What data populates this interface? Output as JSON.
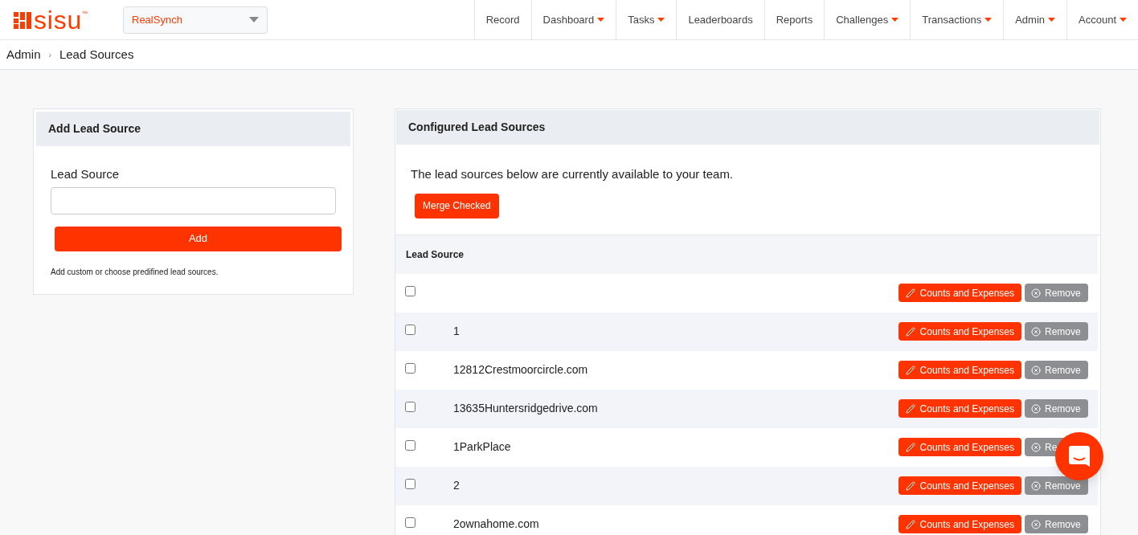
{
  "logo": {
    "text": "sisu",
    "mark": "™"
  },
  "team_select": {
    "value": "RealSynch"
  },
  "nav": [
    {
      "label": "Record",
      "has_menu": false
    },
    {
      "label": "Dashboard",
      "has_menu": true
    },
    {
      "label": "Tasks",
      "has_menu": true
    },
    {
      "label": "Leaderboards",
      "has_menu": false
    },
    {
      "label": "Reports",
      "has_menu": false
    },
    {
      "label": "Challenges",
      "has_menu": true
    },
    {
      "label": "Transactions",
      "has_menu": true
    },
    {
      "label": "Admin",
      "has_menu": true
    },
    {
      "label": "Account",
      "has_menu": true
    }
  ],
  "breadcrumb": [
    "Admin",
    "›",
    "Lead Sources"
  ],
  "add_panel": {
    "title": "Add Lead Source",
    "field_label": "Lead Source",
    "button": "Add",
    "help": "Add custom or choose predifined lead sources."
  },
  "configured_panel": {
    "title": "Configured Lead Sources",
    "intro": "The lead sources below are currently available to your team.",
    "merge_button": "Merge Checked",
    "column": "Lead Source",
    "rows": [
      {
        "name": "",
        "checked": false,
        "edit": "Counts and Expenses",
        "remove": "Remove"
      },
      {
        "name": "1",
        "checked": false,
        "edit": "Counts and Expenses",
        "remove": "Remove"
      },
      {
        "name": "12812Crestmoorcircle.com",
        "checked": false,
        "edit": "Counts and Expenses",
        "remove": "Remove"
      },
      {
        "name": "13635Huntersridgedrive.com",
        "checked": false,
        "edit": "Counts and Expenses",
        "remove": "Remove"
      },
      {
        "name": "1ParkPlace",
        "checked": false,
        "edit": "Counts and Expenses",
        "remove": "Re"
      },
      {
        "name": "2",
        "checked": false,
        "edit": "Counts and Expenses",
        "remove": "Remove"
      },
      {
        "name": "2ownahome.com",
        "checked": false,
        "edit": "Counts and Expenses",
        "remove": "Remove"
      }
    ]
  }
}
